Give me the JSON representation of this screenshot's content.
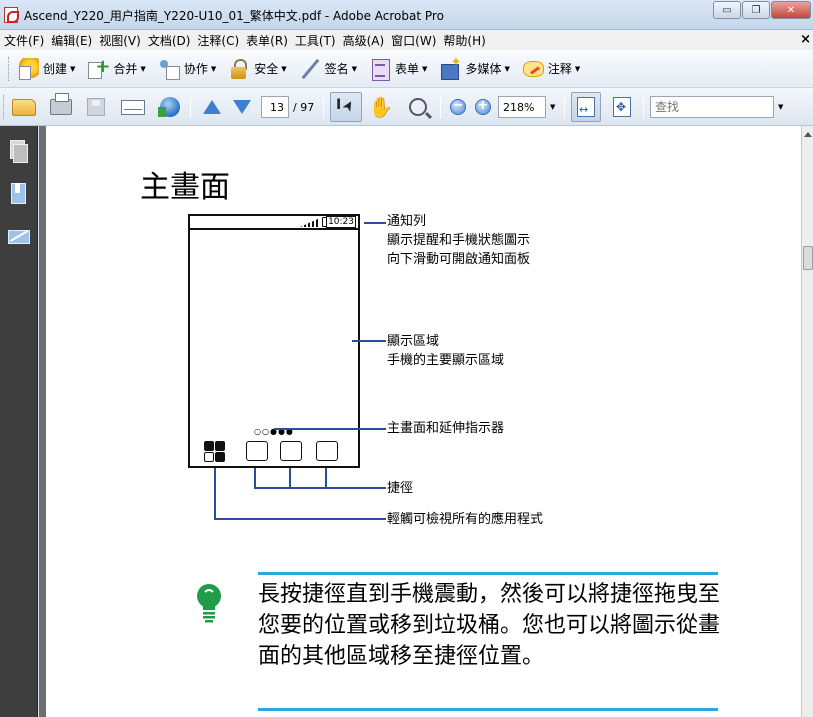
{
  "window": {
    "title": "Ascend_Y220_用户指南_Y220-U10_01_繁体中文.pdf - Adobe Acrobat Pro",
    "buttons": {
      "minimize": "▭",
      "restore": "❐",
      "close": "✕"
    }
  },
  "menubar": {
    "items": [
      "文件(F)",
      "编辑(E)",
      "视图(V)",
      "文档(D)",
      "注释(C)",
      "表单(R)",
      "工具(T)",
      "高级(A)",
      "窗口(W)",
      "帮助(H)"
    ],
    "doc_close": "×"
  },
  "toolbar_tasks": {
    "items": [
      "创建",
      "合并",
      "协作",
      "安全",
      "签名",
      "表单",
      "多媒体",
      "注释"
    ]
  },
  "toolbar_nav": {
    "page_number": "13",
    "page_total": "/ 97",
    "zoom": "218%",
    "search_placeholder": "查找"
  },
  "document": {
    "heading": "主畫面",
    "phone": {
      "time": "10:23"
    },
    "callouts": {
      "notification_title": "通知列",
      "notification_line1": "顯示提醒和手機狀態圖示",
      "notification_line2": "向下滑動可開啟通知面板",
      "display_title": "顯示區域",
      "display_line1": "手機的主要顯示區域",
      "indicator": "主畫面和延伸指示器",
      "shortcuts": "捷徑",
      "apps": "輕觸可檢視所有的應用程式"
    },
    "tip": "長按捷徑直到手機震動，然後可以將捷徑拖曳至您要的位置或移到垃圾桶。您也可以將圖示從畫面的其他區域移至捷徑位置。"
  },
  "colors": {
    "leader_line": "#2a4d9b",
    "tip_rule": "#29a9df",
    "tip_icon": "#1e9c4a",
    "nav_panel": "#3e3e3e"
  }
}
